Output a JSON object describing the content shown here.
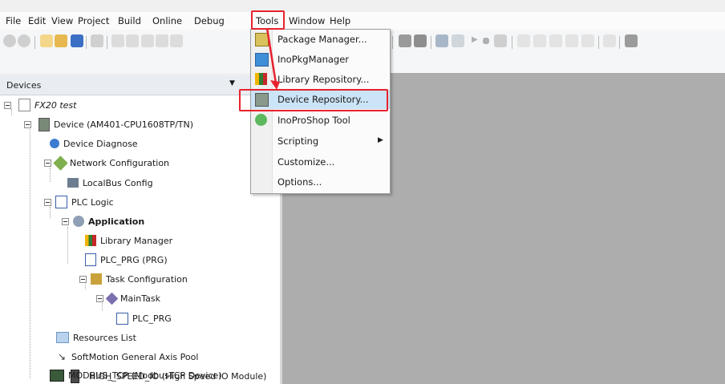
{
  "menubar": {
    "file": "File",
    "edit": "Edit",
    "view": "View",
    "project": "Project",
    "build": "Build",
    "online": "Online",
    "debug": "Debug",
    "tools": "Tools",
    "window": "Window",
    "help": "Help"
  },
  "devices_panel": {
    "title": "Devices"
  },
  "tree": {
    "project": "FX20 test",
    "device": "Device (AM401-CPU1608TP/TN)",
    "device_diagnose": "Device Diagnose",
    "network_configuration": "Network Configuration",
    "localbus_config": "LocalBus Config",
    "plc_logic": "PLC Logic",
    "application": "Application",
    "library_manager": "Library Manager",
    "plc_prg_prg": "PLC_PRG (PRG)",
    "task_configuration": "Task Configuration",
    "main_task": "MainTask",
    "plc_prg": "PLC_PRG",
    "resources_list": "Resources List",
    "softmotion_pool": "SoftMotion General Axis Pool",
    "high_speed_io": "HIGH_SPEED_IO (High Speed IO Module)",
    "modbus_tcp": "MODBUS_TCP (ModbusTCP Device)"
  },
  "tools_menu": {
    "items": [
      {
        "label": "Package Manager...",
        "icon": "package-icon"
      },
      {
        "label": "InoPkgManager",
        "icon": "ino-pkg-icon"
      },
      {
        "label": "Library Repository...",
        "icon": "library-books-icon"
      },
      {
        "label": "Device Repository...",
        "icon": "device-repository-icon"
      },
      {
        "label": "InoProShop Tool",
        "icon": "gear-green-icon"
      },
      {
        "label": "Scripting",
        "icon": "",
        "submenu": true
      },
      {
        "label": "Customize...",
        "icon": ""
      },
      {
        "label": "Options...",
        "icon": ""
      }
    ]
  },
  "colors": {
    "highlight_red": "#e8222d",
    "menu_hover": "#cce4f7",
    "workspace_gray": "#adadad"
  }
}
